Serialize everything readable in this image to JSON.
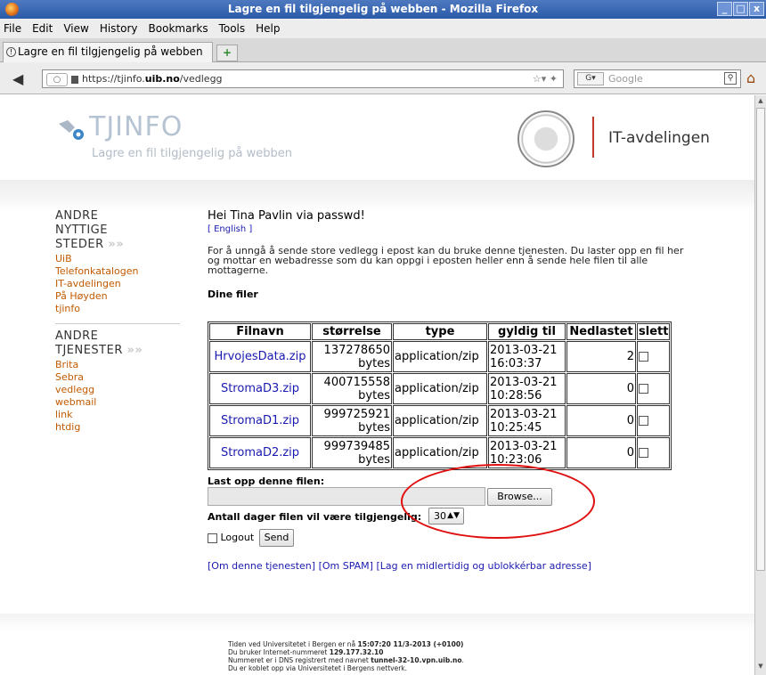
{
  "window": {
    "title": "Lagre en fil tilgjengelig på webben - Mozilla Firefox"
  },
  "menu": [
    {
      "label": "File"
    },
    {
      "label": "Edit"
    },
    {
      "label": "View"
    },
    {
      "label": "History"
    },
    {
      "label": "Bookmarks"
    },
    {
      "label": "Tools"
    },
    {
      "label": "Help"
    }
  ],
  "tab": {
    "label": "Lagre en fil tilgjengelig på webben",
    "new_tab": "+"
  },
  "nav": {
    "url_prefix": "https://tjinfo.",
    "url_domain": "uib.no",
    "url_path": "/vedlegg",
    "search_placeholder": "Google",
    "search_engine": "G▾"
  },
  "header": {
    "logo_title": "TJINFO",
    "logo_subtitle": "Lagre en fil tilgjengelig på webben",
    "department": "IT-avdelingen"
  },
  "sidebar": {
    "section1_title_lines": [
      "ANDRE",
      "NYTTIGE",
      "STEDER"
    ],
    "section1_links": [
      "UiB",
      "Telefonkatalogen",
      "IT-avdelingen",
      "På Høyden",
      "tjinfo"
    ],
    "section2_title_lines": [
      "ANDRE",
      "TJENESTER"
    ],
    "section2_links": [
      "Brita",
      "Sebra",
      "vedlegg",
      "webmail",
      "link",
      "htdig"
    ],
    "arrows": "»»"
  },
  "main": {
    "greeting": "Hei Tina Pavlin via passwd!",
    "english_link": "[ English ]",
    "intro": "For å unngå å sende store vedlegg i epost kan du bruke denne tjenesten. Du laster opp en fil her og mottar en webadresse som du kan oppgi i eposten heller enn å sende hele filen til alle mottagerne.",
    "my_files": "Dine filer"
  },
  "table": {
    "headers": [
      "Filnavn",
      "størrelse",
      "type",
      "gyldig til",
      "Nedlastet",
      "slett"
    ],
    "rows": [
      {
        "name": "HrvojesData.zip",
        "size": "137278650",
        "unit": "bytes",
        "type": "application/zip",
        "date": "2013-03-21",
        "time": "16:03:37",
        "downloads": "2"
      },
      {
        "name": "StromaD3.zip",
        "size": "400715558",
        "unit": "bytes",
        "type": "application/zip",
        "date": "2013-03-21",
        "time": "10:28:56",
        "downloads": "0"
      },
      {
        "name": "StromaD1.zip",
        "size": "999725921",
        "unit": "bytes",
        "type": "application/zip",
        "date": "2013-03-21",
        "time": "10:25:45",
        "downloads": "0"
      },
      {
        "name": "StromaD2.zip",
        "size": "999739485",
        "unit": "bytes",
        "type": "application/zip",
        "date": "2013-03-21",
        "time": "10:23:06",
        "downloads": "0"
      }
    ]
  },
  "upload": {
    "label": "Last opp denne filen:",
    "browse": "Browse...",
    "days_label": "Antall dager filen vil være tilgjengelig:",
    "days_value": "30",
    "logout": "Logout",
    "send": "Send"
  },
  "footlinks": {
    "about": "[Om denne tjenesten]",
    "spam": "[Om SPAM]",
    "temp": "[Lag en midlertidig og ublokkérbar adresse]"
  },
  "footer": {
    "line1_pre": "Tiden ved Universitetet i Bergen er nå ",
    "line1_b": "15:07:20 11/3-2013 (+0100)",
    "line2_pre": "Du bruker Internet-nummeret ",
    "line2_b": "129.177.32.10",
    "line3_pre": "Nummeret er i DNS registrert med navnet ",
    "line3_b": "tunnel-32-10.vpn.uib.no",
    "line3_post": ".",
    "line4": "Du er koblet opp via Universitetet i Bergens nettverk."
  },
  "colors": {
    "link": "#1a1ab0",
    "sidebar_link": "#c25a00",
    "annotation": "#e01010",
    "divider": "#c0392b"
  }
}
